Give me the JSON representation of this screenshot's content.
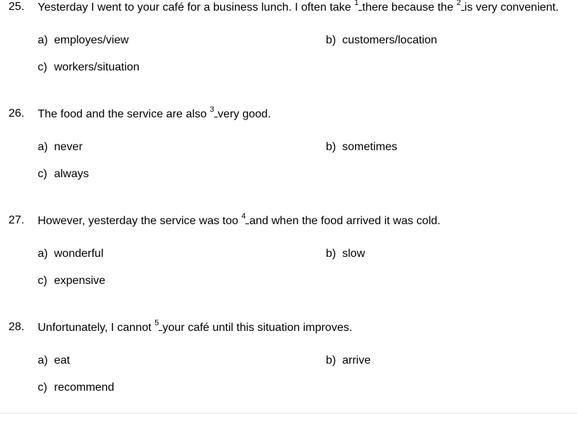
{
  "questions": [
    {
      "number": "25.",
      "parts": [
        "Yesterday I went to your café for a business lunch. I often take ",
        "1",
        "there because the ",
        "2",
        "is very convenient."
      ],
      "options": [
        {
          "letter": "a)",
          "text": "employes/view"
        },
        {
          "letter": "b)",
          "text": "customers/location"
        },
        {
          "letter": "c)",
          "text": "workers/situation"
        }
      ]
    },
    {
      "number": "26.",
      "parts": [
        "The food and the service are also ",
        "3",
        "very good."
      ],
      "options": [
        {
          "letter": "a)",
          "text": "never"
        },
        {
          "letter": "b)",
          "text": "sometimes"
        },
        {
          "letter": "c)",
          "text": "always"
        }
      ]
    },
    {
      "number": "27.",
      "parts": [
        "However, yesterday the service was too ",
        "4",
        "and when the food arrived it was cold."
      ],
      "options": [
        {
          "letter": "a)",
          "text": "wonderful"
        },
        {
          "letter": "b)",
          "text": "slow"
        },
        {
          "letter": "c)",
          "text": "expensive"
        }
      ]
    },
    {
      "number": "28.",
      "parts": [
        "Unfortunately, I cannot ",
        "5",
        "your café until this situation improves."
      ],
      "options": [
        {
          "letter": "a)",
          "text": "eat"
        },
        {
          "letter": "b)",
          "text": "arrive"
        },
        {
          "letter": "c)",
          "text": "recommend"
        }
      ]
    }
  ]
}
